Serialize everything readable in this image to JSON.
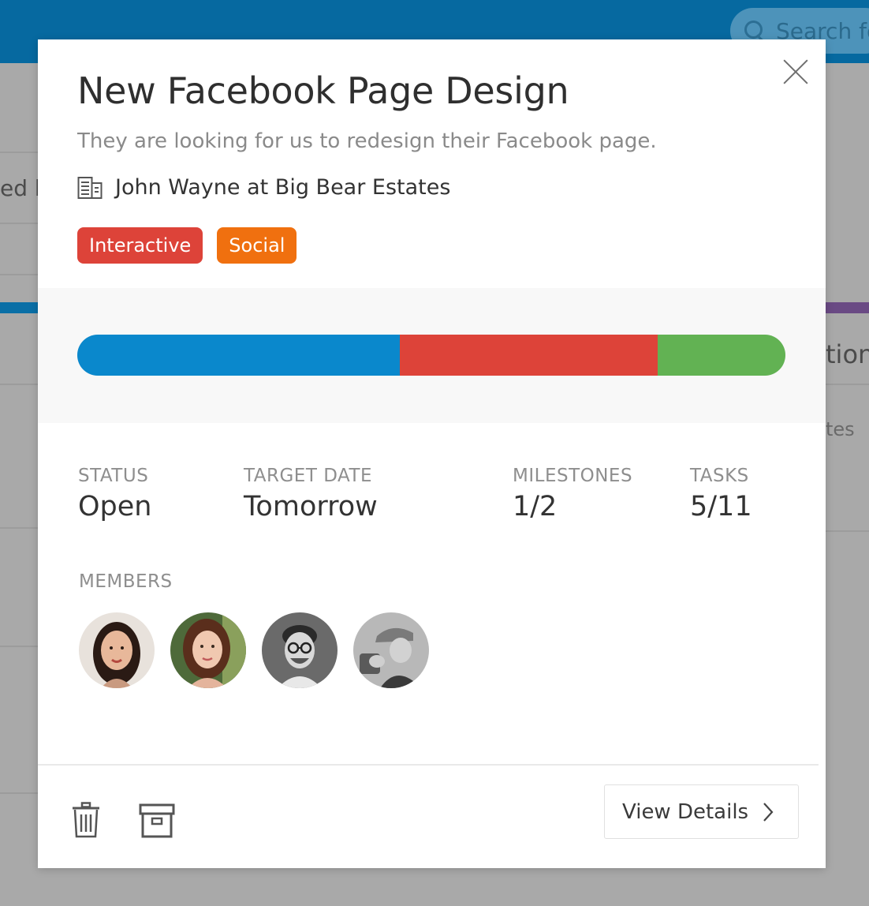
{
  "background": {
    "search_placeholder": "Search fo",
    "partial_left_text": "ed b",
    "partial_right_text_1": "tion",
    "partial_right_text_2": "tes"
  },
  "modal": {
    "title": "New Facebook Page Design",
    "description": "They are looking for us to redesign their Facebook page.",
    "client": "John Wayne at Big Bear Estates",
    "tags": [
      {
        "label": "Interactive",
        "color": "#dd4339"
      },
      {
        "label": "Social",
        "color": "#f0700f"
      }
    ],
    "progress": [
      {
        "fraction": 0.455,
        "color": "#0a88cc"
      },
      {
        "fraction": 0.365,
        "color": "#dd4339"
      },
      {
        "fraction": 0.18,
        "color": "#62b253"
      }
    ],
    "stats": {
      "status": {
        "label": "STATUS",
        "value": "Open"
      },
      "target_date": {
        "label": "TARGET DATE",
        "value": "Tomorrow"
      },
      "milestones": {
        "label": "MILESTONES",
        "value": "1/2"
      },
      "tasks": {
        "label": "TASKS",
        "value": "5/11"
      }
    },
    "members_label": "MEMBERS",
    "members": [
      {
        "avatar_style": "color"
      },
      {
        "avatar_style": "color"
      },
      {
        "avatar_style": "grayscale"
      },
      {
        "avatar_style": "grayscale"
      }
    ],
    "footer": {
      "delete_icon": "trash-icon",
      "archive_icon": "archive-box-icon",
      "view_details_label": "View Details"
    }
  }
}
